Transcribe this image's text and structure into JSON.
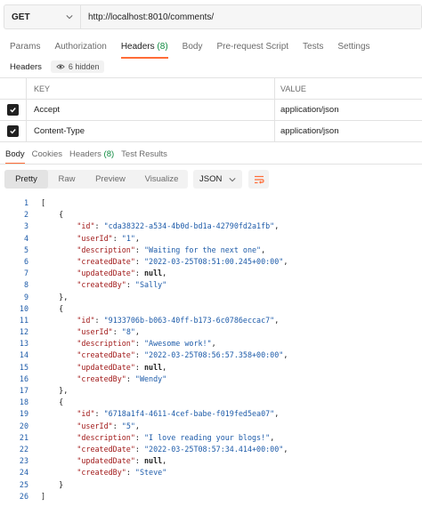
{
  "request": {
    "method": "GET",
    "url": "http://localhost:8010/comments/"
  },
  "request_tabs": [
    {
      "label": "Params"
    },
    {
      "label": "Authorization"
    },
    {
      "label": "Headers",
      "count": "(8)"
    },
    {
      "label": "Body"
    },
    {
      "label": "Pre-request Script"
    },
    {
      "label": "Tests"
    },
    {
      "label": "Settings"
    }
  ],
  "headers_section": {
    "label": "Headers",
    "hidden_label": "6 hidden"
  },
  "headers_table": {
    "columns": {
      "key": "KEY",
      "value": "VALUE"
    },
    "rows": [
      {
        "key": "Accept",
        "value": "application/json",
        "checked": true
      },
      {
        "key": "Content-Type",
        "value": "application/json",
        "checked": true
      }
    ]
  },
  "response_tabs": [
    {
      "label": "Body"
    },
    {
      "label": "Cookies"
    },
    {
      "label": "Headers",
      "count": "(8)"
    },
    {
      "label": "Test Results"
    }
  ],
  "view_modes": [
    "Pretty",
    "Raw",
    "Preview",
    "Visualize"
  ],
  "format": "JSON",
  "colors": {
    "accent": "#ff6c37",
    "json_key": "#a11a1a",
    "json_string": "#1d5ba9",
    "count_green": "#0e8a3f"
  },
  "response_json": [
    {
      "id": "cda38322-a534-4b0d-bd1a-42790fd2a1fb",
      "userId": "1",
      "description": "Waiting for the next one",
      "createdDate": "2022-03-25T08:51:00.245+00:00",
      "updatedDate": "null",
      "createdBy": "Sally"
    },
    {
      "id": "9133706b-b063-40ff-b173-6c0786eccac7",
      "userId": "8",
      "description": "Awesome work!",
      "createdDate": "2022-03-25T08:56:57.358+00:00",
      "updatedDate": "null",
      "createdBy": "Wendy"
    },
    {
      "id": "6718a1f4-4611-4cef-babe-f019fed5ea07",
      "userId": "5",
      "description": "I love reading your blogs!",
      "createdDate": "2022-03-25T08:57:34.414+00:00",
      "updatedDate": "null",
      "createdBy": "Steve"
    }
  ]
}
